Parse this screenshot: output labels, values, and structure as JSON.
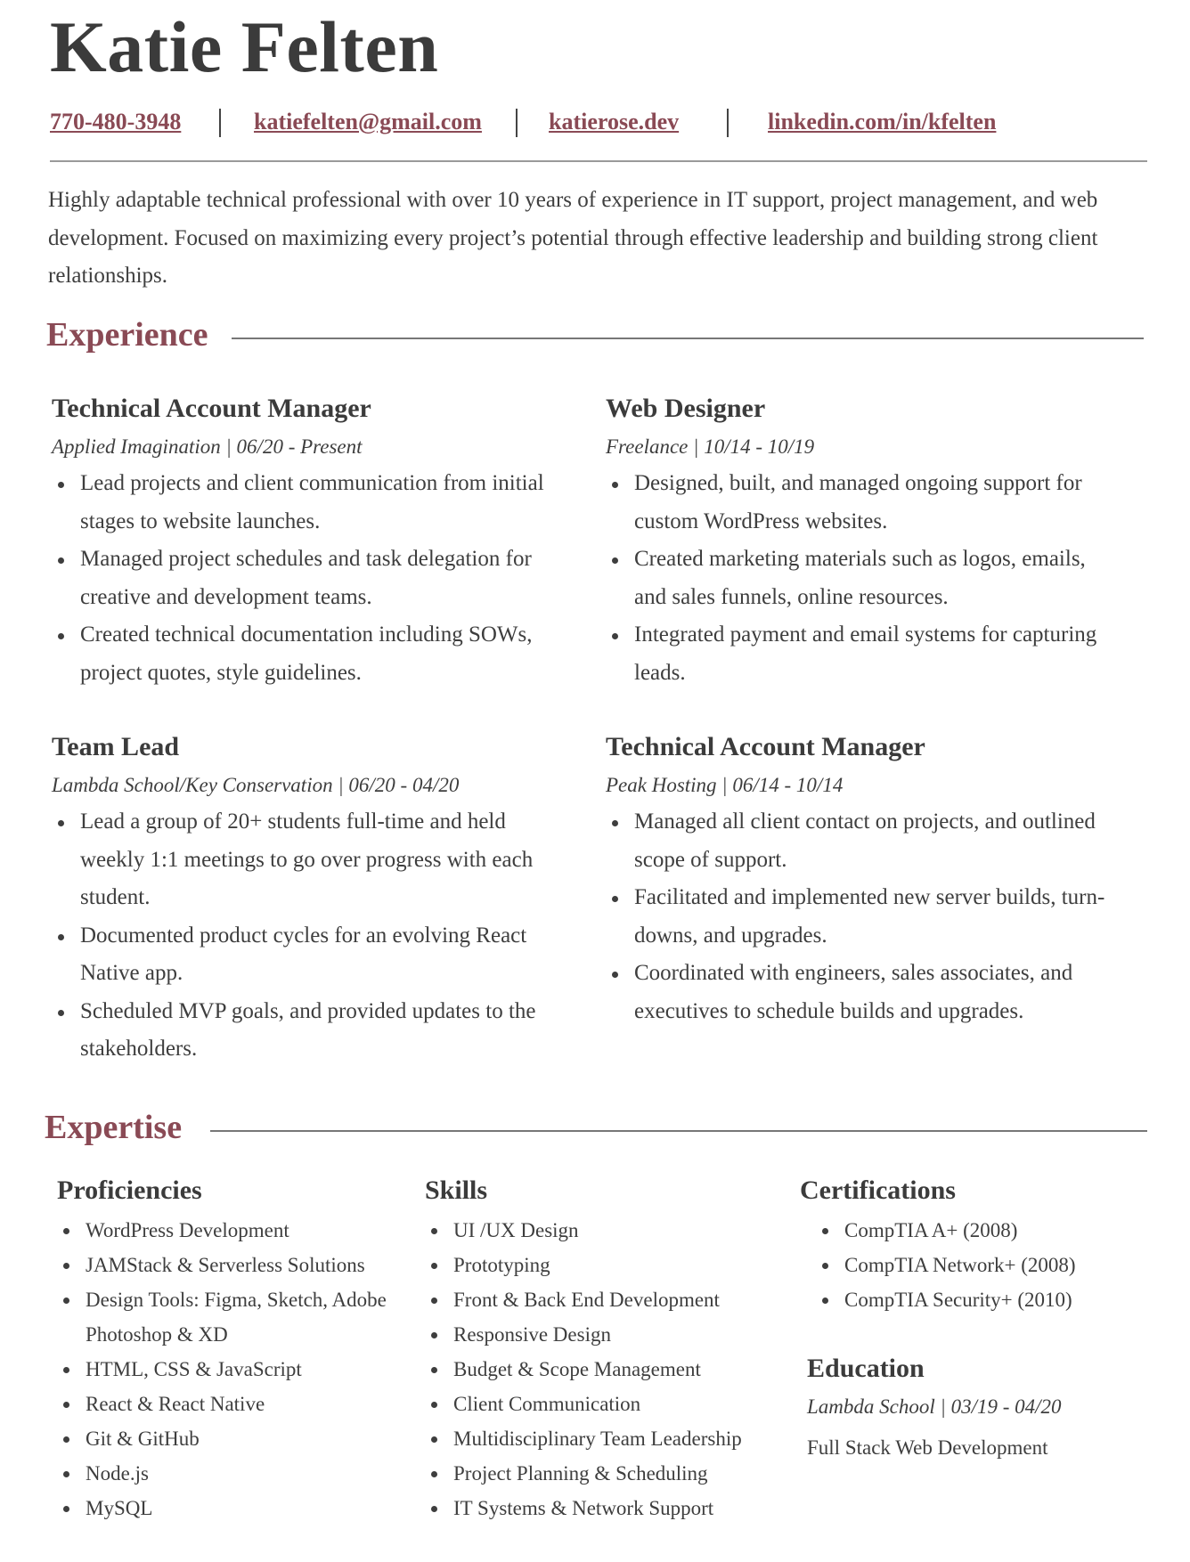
{
  "header": {
    "name": "Katie Felten",
    "phone": "770-480-3948",
    "email": "katiefelten@gmail.com",
    "website": "katierose.dev",
    "linkedin": "linkedin.com/in/kfelten"
  },
  "summary": "Highly adaptable technical professional with over 10 years of experience in IT support, project management, and web development. Focused on maximizing every project’s potential through effective leadership and building strong client relationships.",
  "experience": {
    "title": "Experience",
    "jobs": [
      {
        "title": "Technical Account Manager",
        "meta": "Applied Imagination  |  06/20 - Present",
        "bullets": [
          "Lead projects and client communication from initial stages to website launches.",
          "Managed project schedules and task delegation for creative and development teams.",
          "Created technical documentation including SOWs, project quotes, style guidelines."
        ]
      },
      {
        "title": "Web Designer",
        "meta": "Freelance | 10/14 - 10/19",
        "bullets": [
          "Designed, built, and managed ongoing support for custom WordPress websites.",
          "Created marketing materials such as logos, emails, and sales funnels, online resources.",
          "Integrated payment and email systems for capturing leads."
        ]
      },
      {
        "title": "Team Lead",
        "meta": "Lambda School/Key Conservation  |  06/20 - 04/20",
        "bullets": [
          "Lead a group of 20+ students full-time and held weekly 1:1 meetings to go over progress with each student.",
          "Documented product cycles for an evolving React Native app.",
          "Scheduled MVP goals, and provided updates to the stakeholders."
        ]
      },
      {
        "title": "Technical Account Manager",
        "meta": "Peak Hosting  |  06/14 - 10/14",
        "bullets": [
          "Managed all client contact on projects, and outlined scope of support.",
          "Facilitated and implemented new server builds, turn-downs, and upgrades.",
          "Coordinated with engineers, sales associates, and executives to schedule builds and upgrades."
        ]
      }
    ]
  },
  "expertise": {
    "title": "Expertise",
    "proficiencies": {
      "title": "Proficiencies",
      "items": [
        "WordPress Development",
        "JAMStack & Serverless Solutions",
        "Design Tools: Figma, Sketch, Adobe Photoshop & XD",
        "HTML, CSS & JavaScript",
        "React & React Native",
        "Git & GitHub",
        "Node.js",
        "MySQL"
      ]
    },
    "skills": {
      "title": "Skills",
      "items": [
        "UI /UX Design",
        "Prototyping",
        "Front & Back End Development",
        "Responsive Design",
        "Budget & Scope Management",
        "Client Communication",
        "Multidisciplinary Team Leadership",
        "Project Planning & Scheduling",
        "IT Systems & Network Support"
      ]
    },
    "certifications": {
      "title": "Certifications",
      "items": [
        "CompTIA A+ (2008)",
        "CompTIA Network+ (2008)",
        "CompTIA Security+ (2010)"
      ]
    },
    "education": {
      "title": "Education",
      "meta": "Lambda School  |  03/19 - 04/20",
      "degree": "Full Stack Web Development"
    }
  }
}
